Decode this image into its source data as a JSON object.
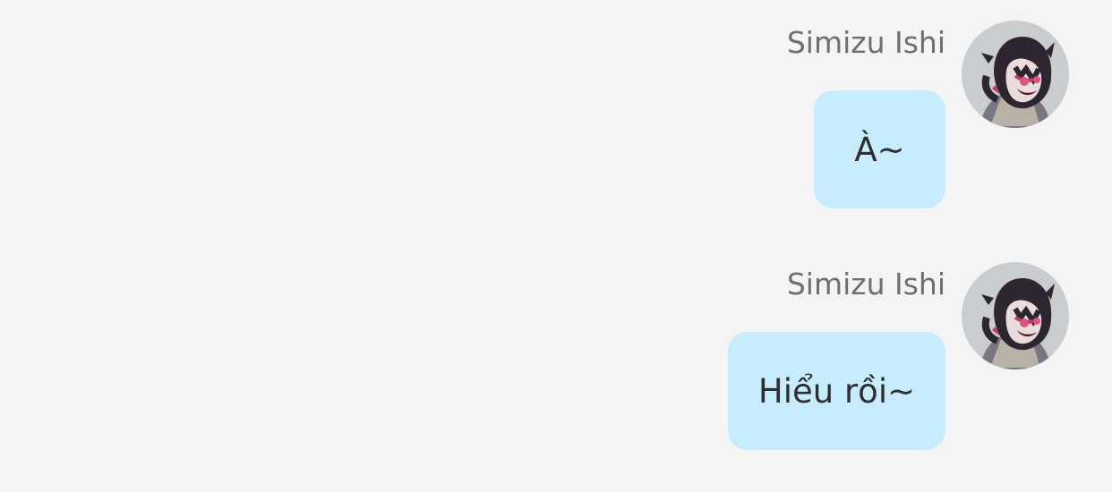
{
  "colors": {
    "background": "#f4f4f4",
    "bubble": "#c6ecfd",
    "sender_text": "#6f6f6f",
    "message_text": "#2f2f2f"
  },
  "messages": [
    {
      "sender": "Simizu Ishi",
      "text": "À~",
      "avatar_icon": "anime-avatar"
    },
    {
      "sender": "Simizu Ishi",
      "text": "Hiểu rồi~",
      "avatar_icon": "anime-avatar"
    }
  ]
}
